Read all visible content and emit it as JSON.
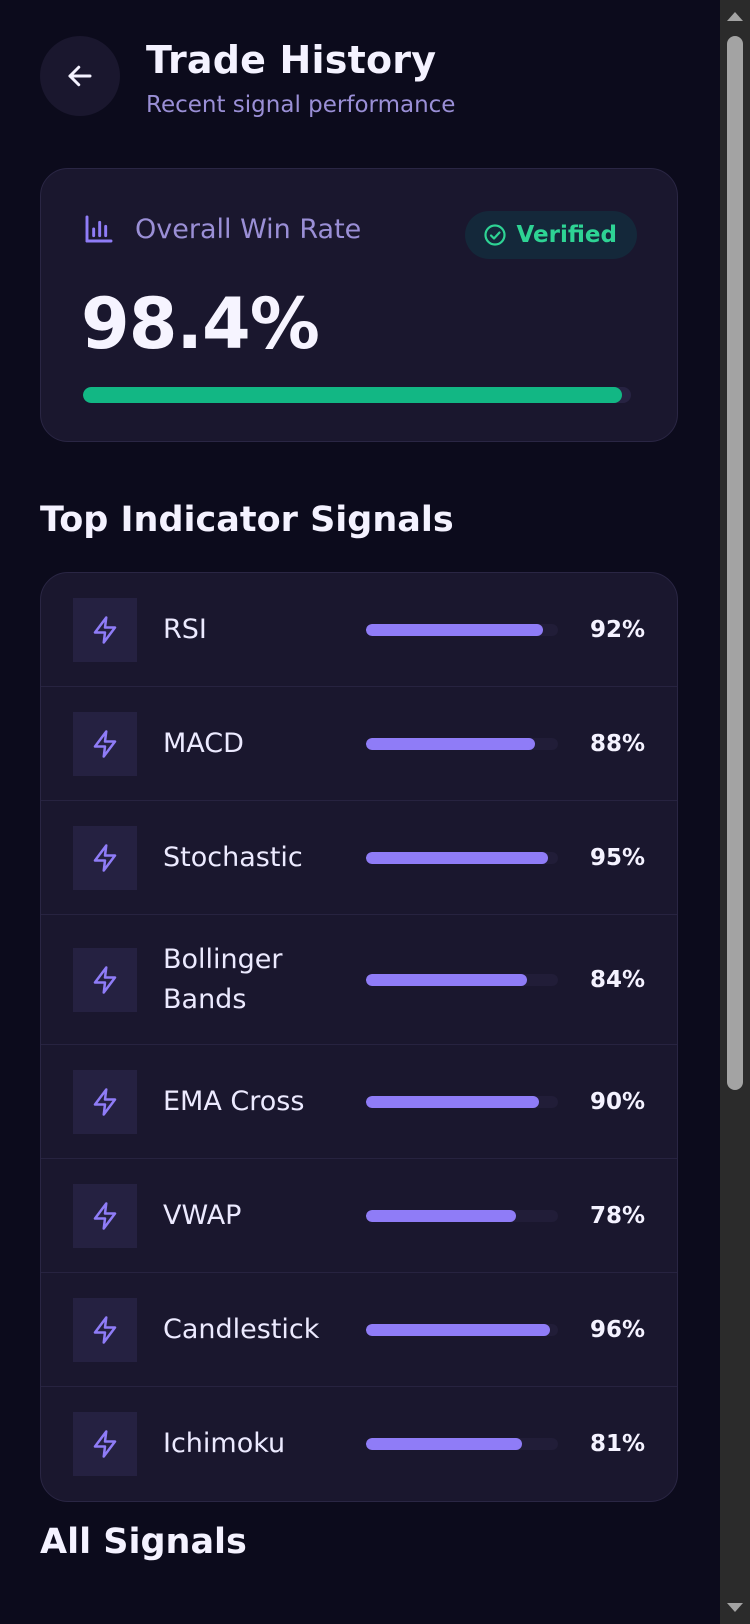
{
  "header": {
    "title": "Trade History",
    "subtitle": "Recent signal performance",
    "back_icon": "arrow-left-icon"
  },
  "win_rate": {
    "label": "Overall Win Rate",
    "value": "98.4%",
    "progress_percent": 98.4,
    "badge": "Verified",
    "bar_color": "#12b784",
    "badge_color": "#2ed394"
  },
  "indicators": {
    "section_title": "Top Indicator Signals",
    "bar_color": "#8f7cf7",
    "items": [
      {
        "name": "RSI",
        "percent": "92%",
        "value": 92
      },
      {
        "name": "MACD",
        "percent": "88%",
        "value": 88
      },
      {
        "name": "Stochastic",
        "percent": "95%",
        "value": 95
      },
      {
        "name": "Bollinger Bands",
        "percent": "84%",
        "value": 84
      },
      {
        "name": "EMA Cross",
        "percent": "90%",
        "value": 90
      },
      {
        "name": "VWAP",
        "percent": "78%",
        "value": 78
      },
      {
        "name": "Candlestick",
        "percent": "96%",
        "value": 96
      },
      {
        "name": "Ichimoku",
        "percent": "81%",
        "value": 81
      }
    ]
  },
  "all_signals": {
    "section_title": "All Signals"
  }
}
